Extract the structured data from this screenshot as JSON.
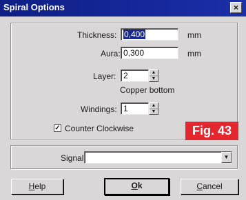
{
  "window": {
    "title": "Spiral Options",
    "close_glyph": "×"
  },
  "thickness": {
    "label": "Thickness:",
    "value": "0,400",
    "unit": "mm"
  },
  "aura": {
    "label": "Aura:",
    "value": "0,300",
    "unit": "mm"
  },
  "layer": {
    "label": "Layer:",
    "value": "2",
    "layer_name": "Copper bottom"
  },
  "windings": {
    "label": "Windings:",
    "value": "1"
  },
  "counter_clockwise": {
    "label": "Counter Clockwise",
    "checked": true,
    "mark": "✓"
  },
  "figure_badge": "Fig. 43",
  "signal": {
    "label": "Signal:",
    "value": "",
    "arrow": "▼"
  },
  "buttons": {
    "help_first": "H",
    "help_rest": "elp",
    "ok_first": "O",
    "ok_rest": "k",
    "cancel_first": "C",
    "cancel_rest": "ancel"
  },
  "spinner": {
    "up": "▲",
    "down": "▼"
  },
  "colors": {
    "titlebar": "#15279a",
    "badge": "#e4262f",
    "face": "#d9d7d8"
  }
}
